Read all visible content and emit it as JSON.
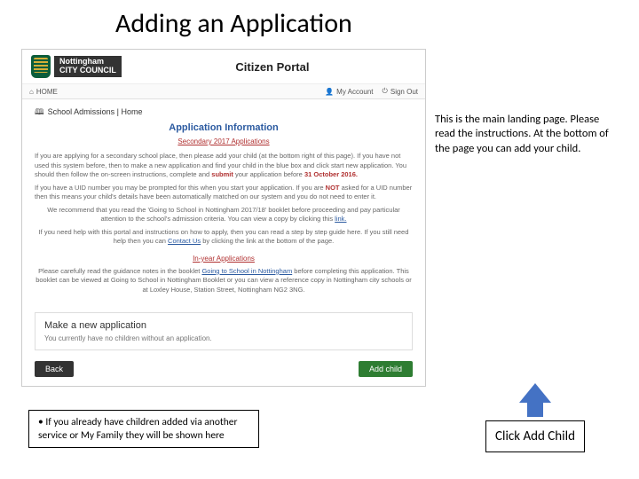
{
  "slide": {
    "title": "Adding an Application"
  },
  "council": {
    "line1": "Nottingham",
    "line2": "CITY COUNCIL"
  },
  "portal": {
    "title": "Citizen Portal",
    "nav": {
      "home": "HOME",
      "account": "My Account",
      "signout": "Sign Out",
      "breadcrumb": "School Admissions | Home"
    },
    "app_info_heading": "Application Information",
    "sub_heading": "Secondary 2017 Applications",
    "p1a": "If you are applying for a secondary school place, then please add your child (at the bottom right of this page). If you have not used this system before, then to make a new application and find your child in the blue box and click start new application. You should then follow the on-screen instructions, complete and ",
    "p1_submit": "submit",
    "p1b": " your application before ",
    "p1_deadline": "31 October 2016.",
    "p2a": "If you have a UID number you may be prompted for this when you start your application. If you are ",
    "p2_not": "NOT",
    "p2b": " asked for a UID number then this means your child's details have been automatically matched on our system and you do not need to enter it.",
    "p3a": "We recommend that you read the 'Going to School in Nottingham 2017/18' booklet before proceeding and pay particular attention to the school's admission criteria. You can view a copy by clicking this ",
    "p3_link": "link.",
    "p4a": "If you need help with this portal and instructions on how to apply, then you can read a step by step guide here. If you still need help then you can ",
    "p4_contact": "Contact Us",
    "p4b": " by clicking the link at the bottom of the page.",
    "inyear": "In-year Applications",
    "p5a": "Please carefully read the guidance notes in the booklet ",
    "p5_link": "Going to School in Nottingham",
    "p5b": " before completing this application. This booklet can be viewed at Going to School in Nottingham Booklet or you can view a reference copy in Nottingham city schools or at Loxley House, Station Street, Nottingham NG2 3NG.",
    "new_app_title": "Make a new application",
    "new_app_sub": "You currently have no children without an application.",
    "back": "Back",
    "add_child": "Add child"
  },
  "side_note": "This is the main landing page. Please read the instructions. At the bottom of the page you can add your child.",
  "bottom_note": "• If you already have children added via another service or My Family they will be shown here",
  "callout": "Click Add Child"
}
